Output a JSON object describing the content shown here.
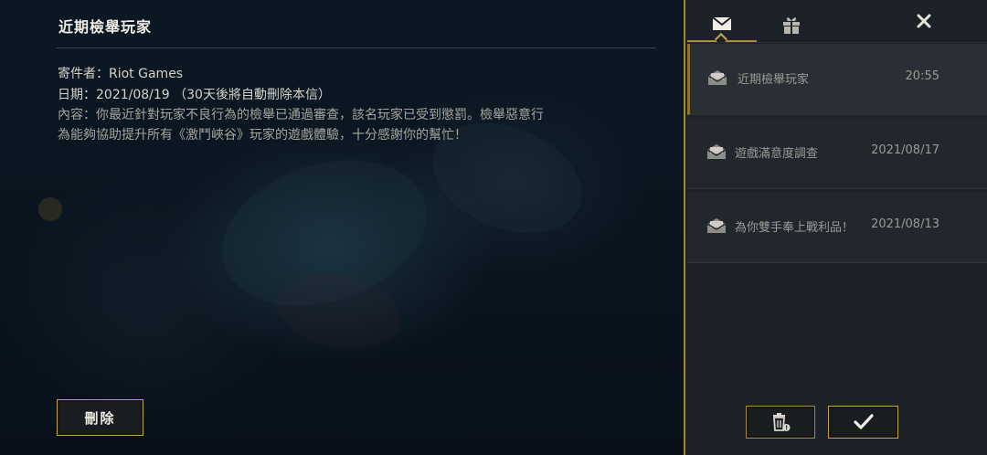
{
  "detail": {
    "title": "近期檢舉玩家",
    "sender_label": "寄件者：",
    "sender": "Riot Games",
    "date_label": "日期：",
    "date": "2021/08/19 （30天後將自動刪除本信）",
    "content_label": "內容：",
    "content": "你最近針對玩家不良行為的檢舉已通過審查，該名玩家已受到懲罰。檢舉惡意行為能夠協助提升所有《激鬥峽谷》玩家的遊戲體驗，十分感謝你的幫忙！",
    "delete_label": "刪除"
  },
  "tabs": [
    {
      "icon": "mail-icon",
      "active": true
    },
    {
      "icon": "gift-icon",
      "active": false
    }
  ],
  "mails": [
    {
      "subject": "近期檢舉玩家",
      "time": "20:55",
      "selected": true,
      "icon": "envelope-open-icon"
    },
    {
      "subject": "遊戲滿意度調查",
      "time": "2021/08/17",
      "selected": false,
      "icon": "envelope-open-icon"
    },
    {
      "subject": "為你雙手奉上戰利品！",
      "time": "2021/08/13",
      "selected": false,
      "icon": "envelope-open-icon"
    }
  ],
  "colors": {
    "accent_gold": "#c7a24c",
    "panel_bg": "#1d2228",
    "detail_bg": "#0a1520"
  },
  "actions": {
    "delete_all_icon": "trash-icon",
    "confirm_icon": "checkmark-icon",
    "close_icon": "close-icon"
  }
}
